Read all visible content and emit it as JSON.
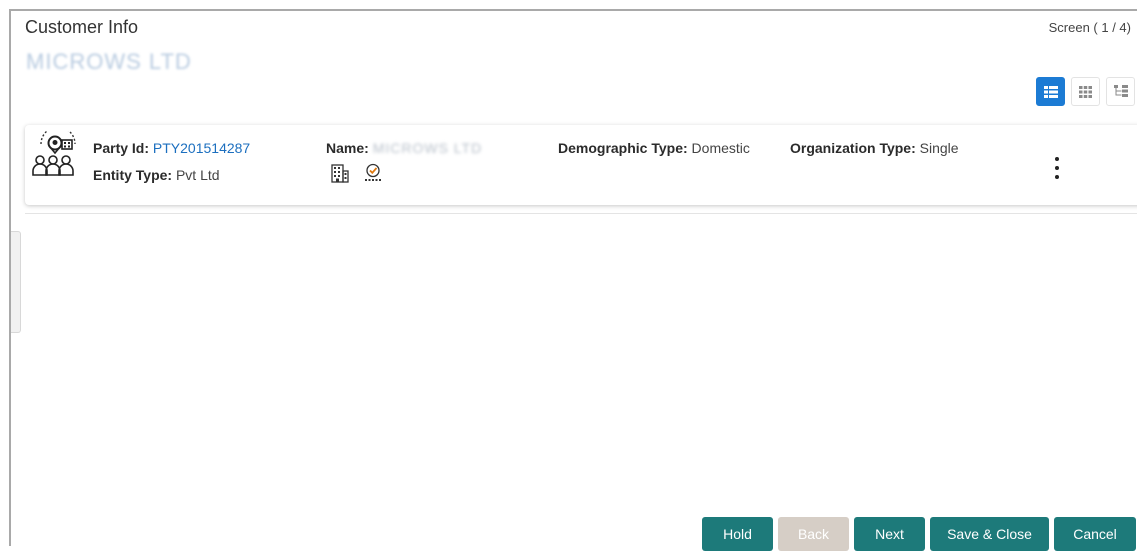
{
  "header": {
    "title": "Customer Info",
    "subtitle": "MICROWS LTD",
    "screen_info": "Screen ( 1 / 4)"
  },
  "view_toggle": {
    "options": [
      "list-view",
      "grid-view",
      "tree-view"
    ],
    "active": "list-view"
  },
  "party_card": {
    "party_id_label": "Party Id:",
    "party_id_value": "PTY201514287",
    "entity_type_label": "Entity Type:",
    "entity_type_value": "Pvt Ltd",
    "name_label": "Name:",
    "name_value": "MICROWS LTD",
    "demographic_type_label": "Demographic Type:",
    "demographic_type_value": "Domestic",
    "organization_type_label": "Organization Type:",
    "organization_type_value": "Single",
    "icons": [
      "party-group-icon",
      "building-icon",
      "verified-badge-icon",
      "more-vertical-icon"
    ]
  },
  "footer": {
    "hold_label": "Hold",
    "back_label": "Back",
    "next_label": "Next",
    "save_close_label": "Save & Close",
    "cancel_label": "Cancel"
  },
  "colors": {
    "accent_blue": "#1c7bd4",
    "link_blue": "#1c6fbf",
    "button_teal": "#1d7a7a",
    "button_disabled": "#d6cec6"
  }
}
